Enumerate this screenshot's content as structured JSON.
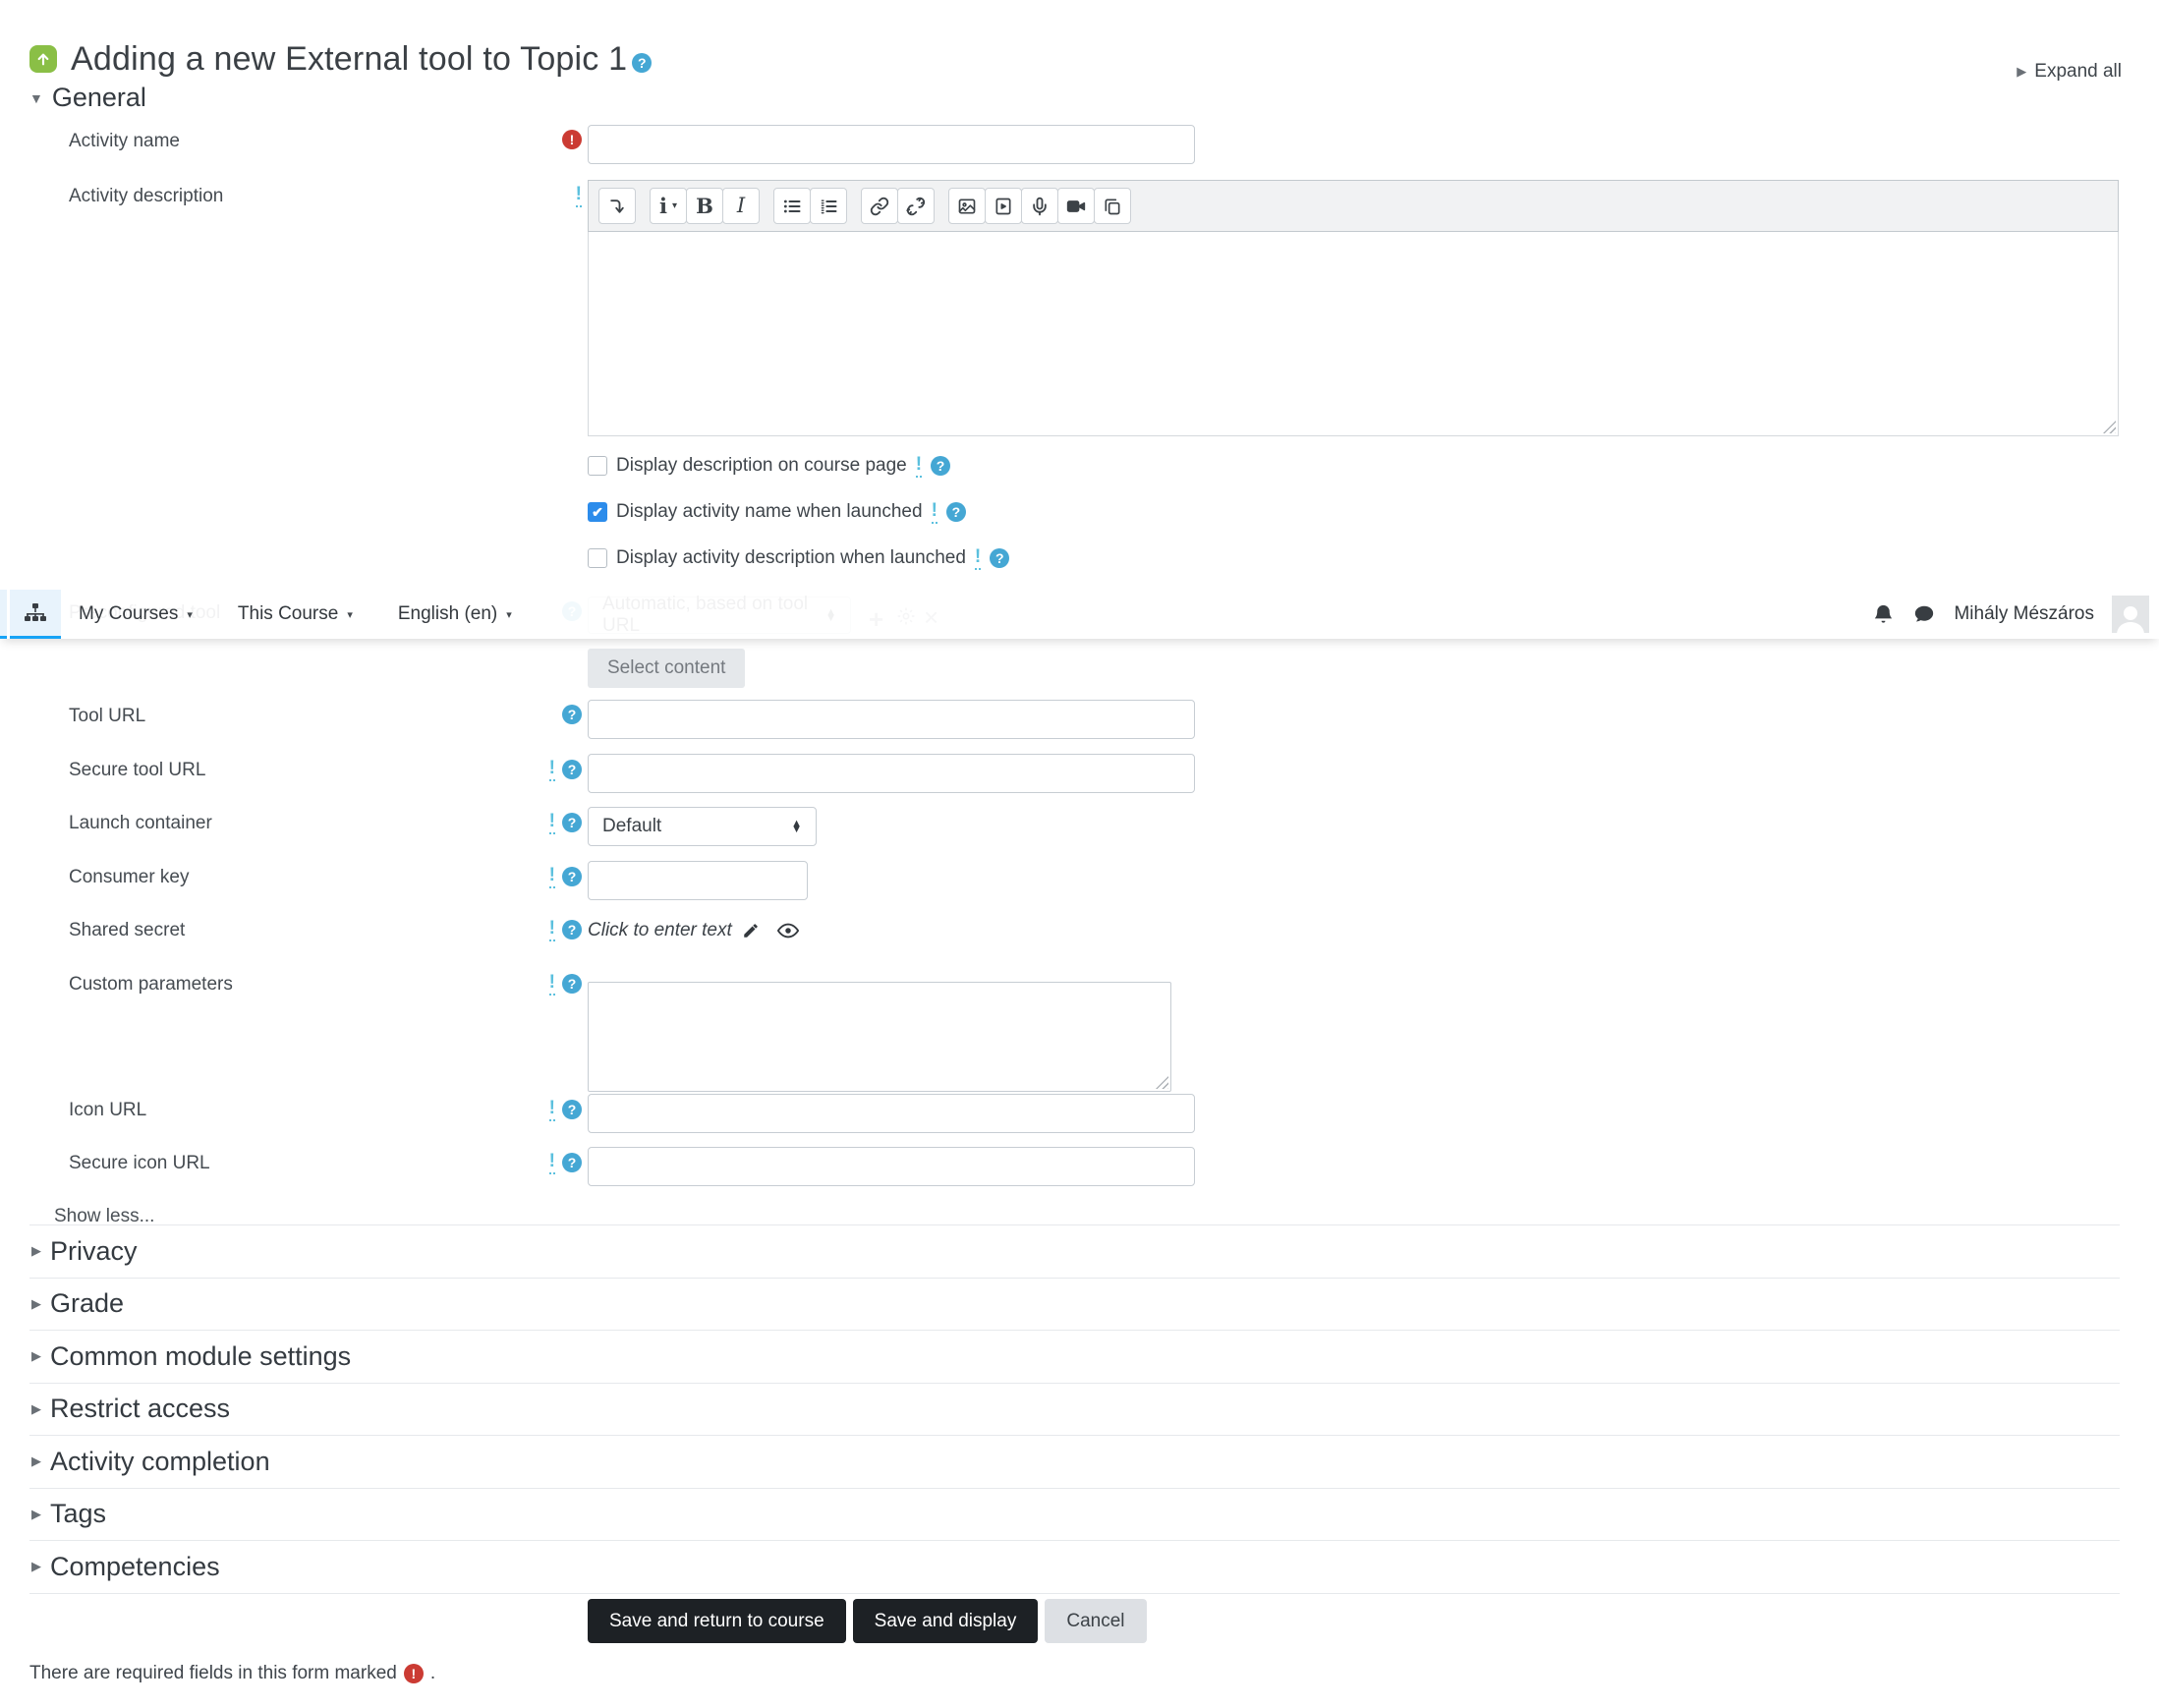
{
  "colors": {
    "accent_blue": "#17a3f6",
    "help_blue": "#45a7d4",
    "info_blue": "#5bc0de",
    "required_red": "#cb3b33",
    "checkbox_blue": "#2c8ceb",
    "button_dark": "#1d2125",
    "lti_green": "#8abf46"
  },
  "icons": {
    "help": "?",
    "required": "!",
    "info": "!",
    "caret": "▾",
    "tri_right": "▶",
    "tri_down": "▼",
    "bold": "B",
    "italic": "I",
    "style": "i",
    "plus": "+",
    "cross": "×"
  },
  "header": {
    "title": "Adding a new External tool to Topic 1",
    "expand_all": "Expand all"
  },
  "navbar": {
    "menus": [
      {
        "label": "My Courses"
      },
      {
        "label": "This Course"
      },
      {
        "label": "English (en)"
      }
    ],
    "user_name": "Mihály Mészáros"
  },
  "general": {
    "heading": "General",
    "activity_name_label": "Activity name",
    "activity_description_label": "Activity description",
    "checkboxes": [
      {
        "label": "Display description on course page",
        "checked": false
      },
      {
        "label": "Display activity name when launched",
        "checked": true
      },
      {
        "label": "Display activity description when launched",
        "checked": false
      }
    ],
    "preconfigured": {
      "label": "Preconfigured tool",
      "value": "Automatic, based on tool URL"
    },
    "select_content": "Select content",
    "fields": {
      "tool_url": {
        "label": "Tool URL"
      },
      "secure_tool_url": {
        "label": "Secure tool URL"
      },
      "launch_container": {
        "label": "Launch container",
        "value": "Default"
      },
      "consumer_key": {
        "label": "Consumer key"
      },
      "shared_secret": {
        "label": "Shared secret",
        "value": "Click to enter text"
      },
      "custom_parameters": {
        "label": "Custom parameters"
      },
      "icon_url": {
        "label": "Icon URL"
      },
      "secure_icon_url": {
        "label": "Secure icon URL"
      }
    },
    "show_less": "Show less..."
  },
  "editor": {
    "buttons": [
      "toolbar-toggle",
      "text-style",
      "bold",
      "italic",
      "unordered-list",
      "ordered-list",
      "link",
      "unlink",
      "insert-image",
      "insert-media",
      "record-audio",
      "record-video",
      "manage-files"
    ]
  },
  "sections": [
    {
      "label": "Privacy"
    },
    {
      "label": "Grade"
    },
    {
      "label": "Common module settings"
    },
    {
      "label": "Restrict access"
    },
    {
      "label": "Activity completion"
    },
    {
      "label": "Tags"
    },
    {
      "label": "Competencies"
    }
  ],
  "actions": {
    "save_return": "Save and return to course",
    "save_display": "Save and display",
    "cancel": "Cancel"
  },
  "footer": {
    "required_note": "There are required fields in this form marked",
    "period": "."
  }
}
